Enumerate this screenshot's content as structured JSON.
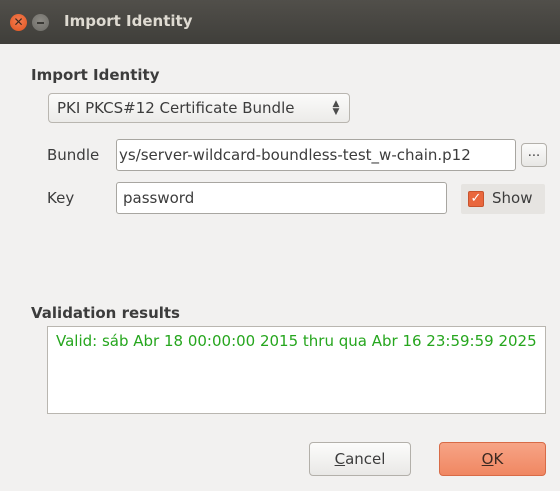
{
  "window": {
    "title": "Import Identity",
    "close_icon": "close-icon",
    "minimize_icon": "minimize-icon"
  },
  "import_group": {
    "title": "Import Identity",
    "type_select": {
      "selected": "PKI PKCS#12 Certificate Bundle",
      "arrow_icon": "updown-chevron-icon"
    },
    "bundle": {
      "label": "Bundle",
      "value": "ys/server-wildcard-boundless-test_w-chain.p12",
      "browse_label": "..."
    },
    "key": {
      "label": "Key",
      "value": "password",
      "show_label": "Show",
      "show_checked": true,
      "check_icon": "checkmark-icon"
    }
  },
  "validation": {
    "title": "Validation results",
    "text": "Valid: sáb Abr 18 00:00:00 2015 thru qua Abr 16 23:59:59 2025",
    "color": "#26a61e"
  },
  "buttons": {
    "cancel_first": "C",
    "cancel_rest": "ancel",
    "ok_first": "O",
    "ok_rest": "K"
  },
  "colors": {
    "titlebar": "#3f3e3a",
    "accent": "#e9673d",
    "ok_button": "#f08762"
  }
}
